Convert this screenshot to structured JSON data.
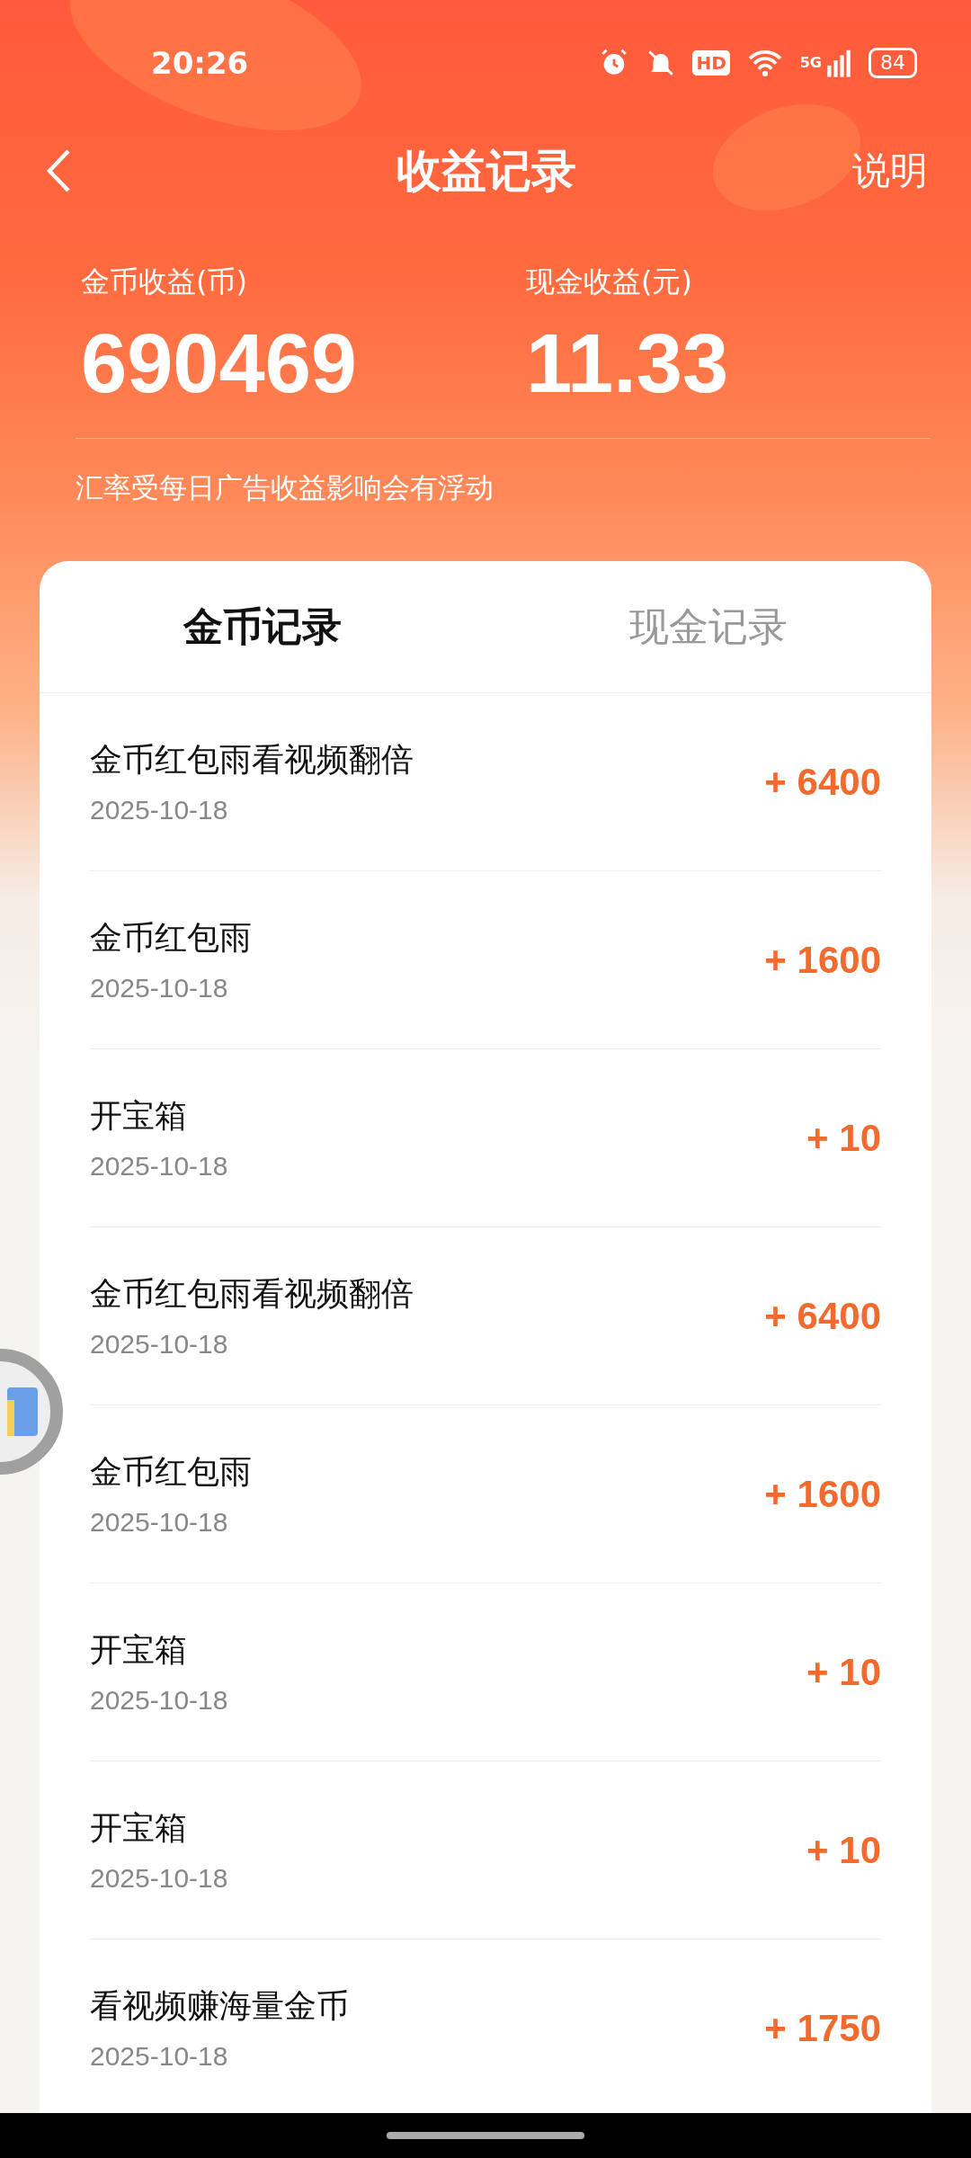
{
  "status_bar": {
    "time": "20:26",
    "hd": "HD",
    "network": "5G",
    "battery": "84"
  },
  "header": {
    "title": "收益记录",
    "action": "说明"
  },
  "stats": [
    {
      "label": "金币收益(币)",
      "value": "690469"
    },
    {
      "label": "现金收益(元)",
      "value": "11.33"
    }
  ],
  "note": "汇率受每日广告收益影响会有浮动",
  "tabs": [
    {
      "label": "金币记录",
      "selected": true
    },
    {
      "label": "现金记录",
      "selected": false
    }
  ],
  "records": [
    {
      "title": "金币红包雨看视频翻倍",
      "date": "2025-10-18",
      "amount": "+ 6400"
    },
    {
      "title": "金币红包雨",
      "date": "2025-10-18",
      "amount": "+ 1600"
    },
    {
      "title": "开宝箱",
      "date": "2025-10-18",
      "amount": "+ 10"
    },
    {
      "title": "金币红包雨看视频翻倍",
      "date": "2025-10-18",
      "amount": "+ 6400"
    },
    {
      "title": "金币红包雨",
      "date": "2025-10-18",
      "amount": "+ 1600"
    },
    {
      "title": "开宝箱",
      "date": "2025-10-18",
      "amount": "+ 10"
    },
    {
      "title": "开宝箱",
      "date": "2025-10-18",
      "amount": "+ 10"
    },
    {
      "title": "看视频赚海量金币",
      "date": "2025-10-18",
      "amount": "+ 1750"
    }
  ]
}
